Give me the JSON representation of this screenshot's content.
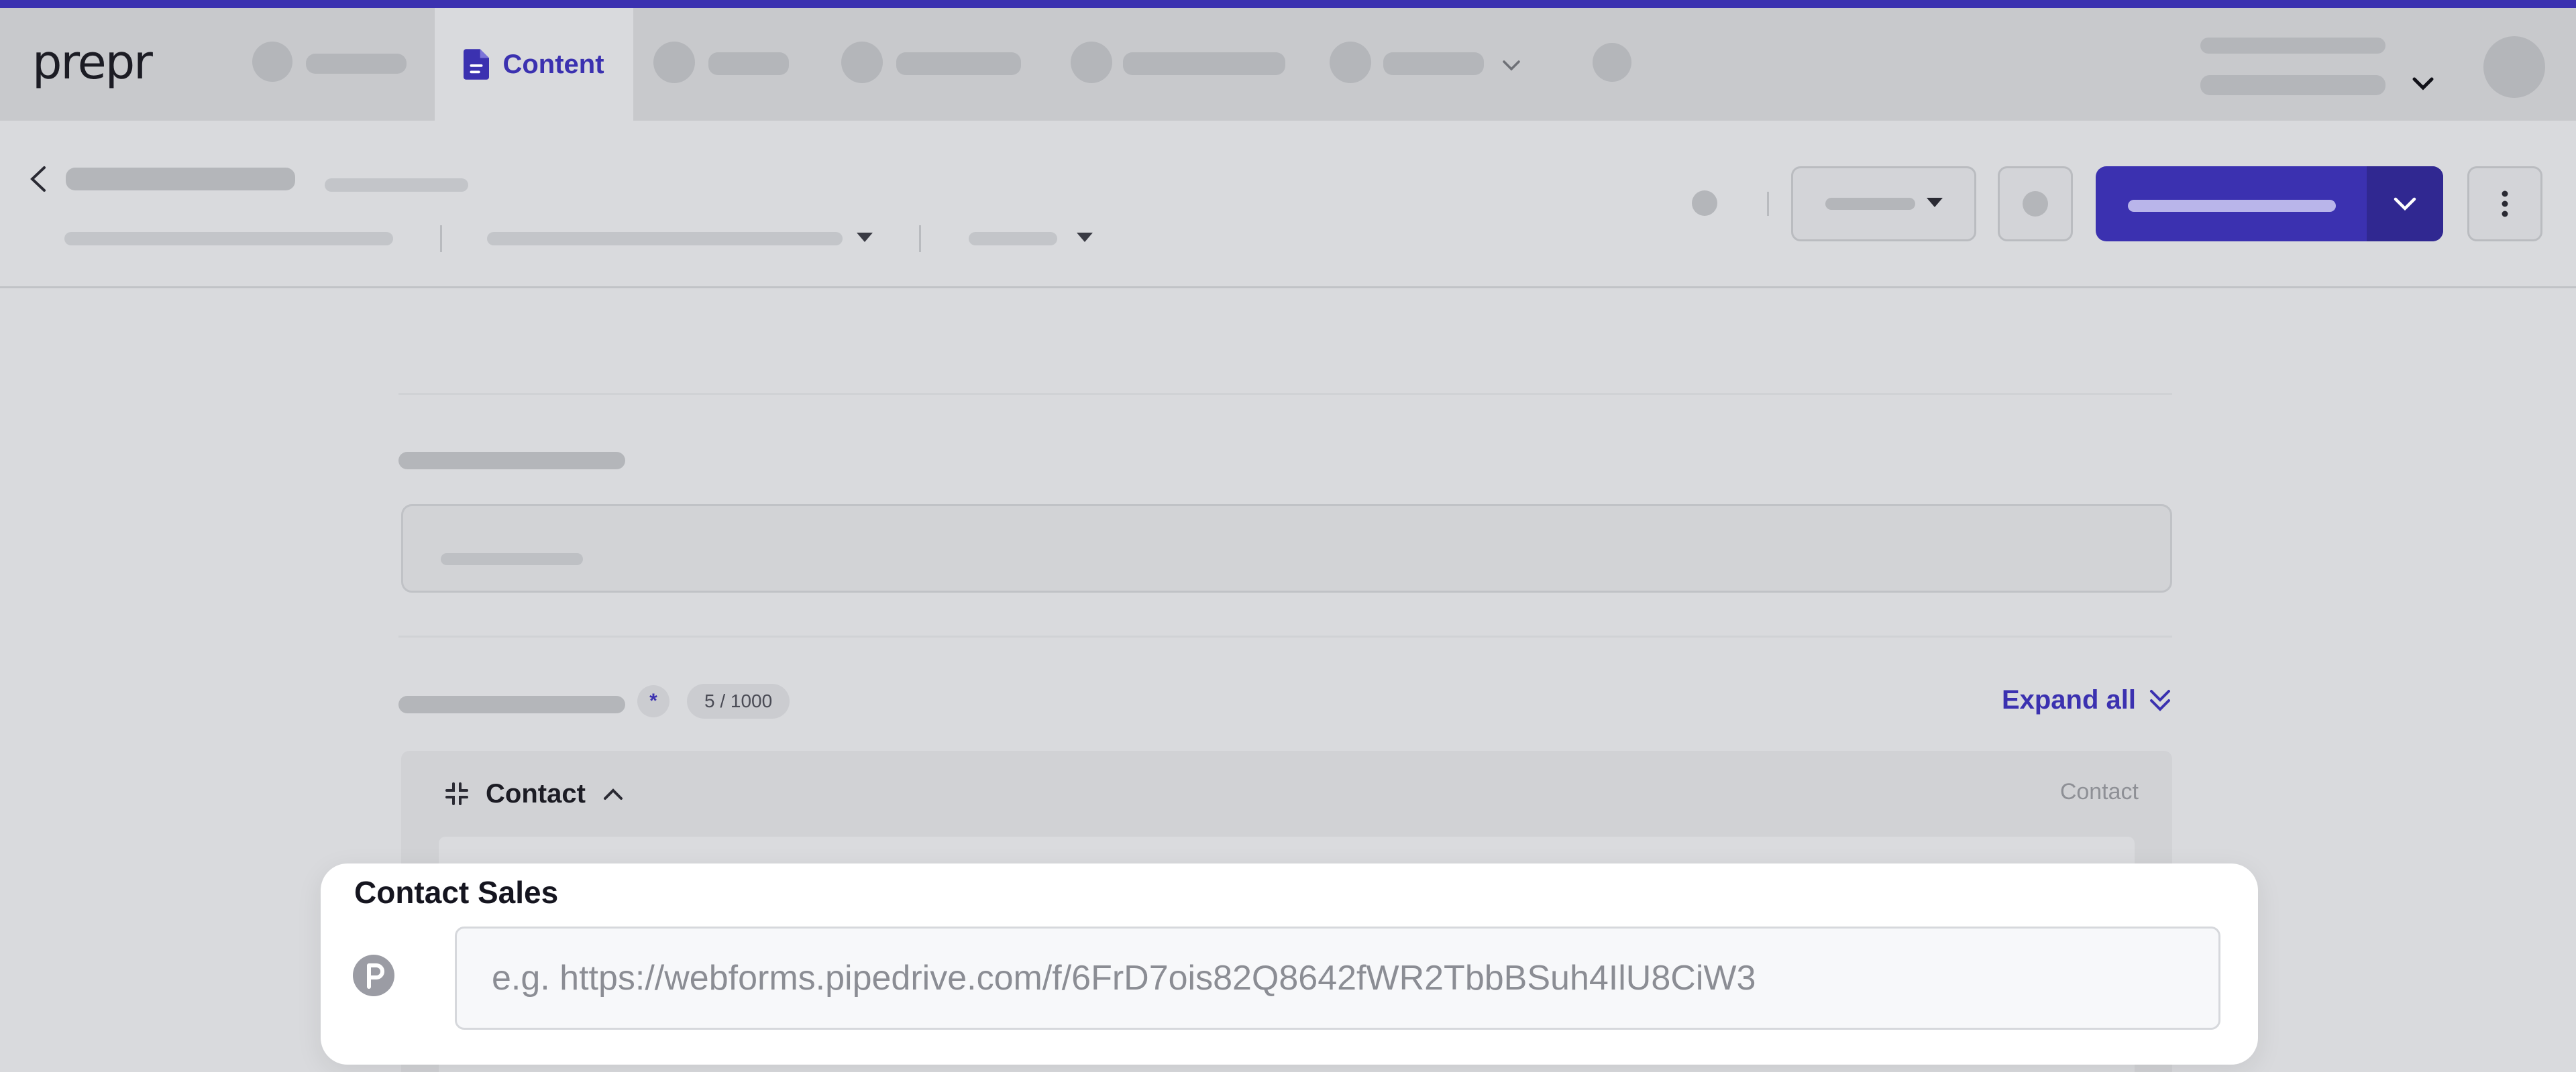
{
  "colors": {
    "accent": "#3b31b0",
    "accent_dark": "#302891",
    "nav_bg": "#c8c9cc",
    "page_bg": "#d9dadd",
    "panel_bg": "#ffffff"
  },
  "brand": {
    "logo_text": "prepr"
  },
  "nav": {
    "active_tab": {
      "label": "Content",
      "icon": "document-icon"
    }
  },
  "main": {
    "required_marker": "*",
    "char_count": "5 / 1000",
    "expand_all_label": "Expand all",
    "component": {
      "name": "Contact",
      "type_label": "Contact"
    }
  },
  "focus_field": {
    "label": "Contact Sales",
    "icon": "pipedrive-icon",
    "value": "",
    "placeholder": "e.g. https://webforms.pipedrive.com/f/6FrD7ois82Q8642fWR2TbbBSuh4IlU8CiW3"
  }
}
